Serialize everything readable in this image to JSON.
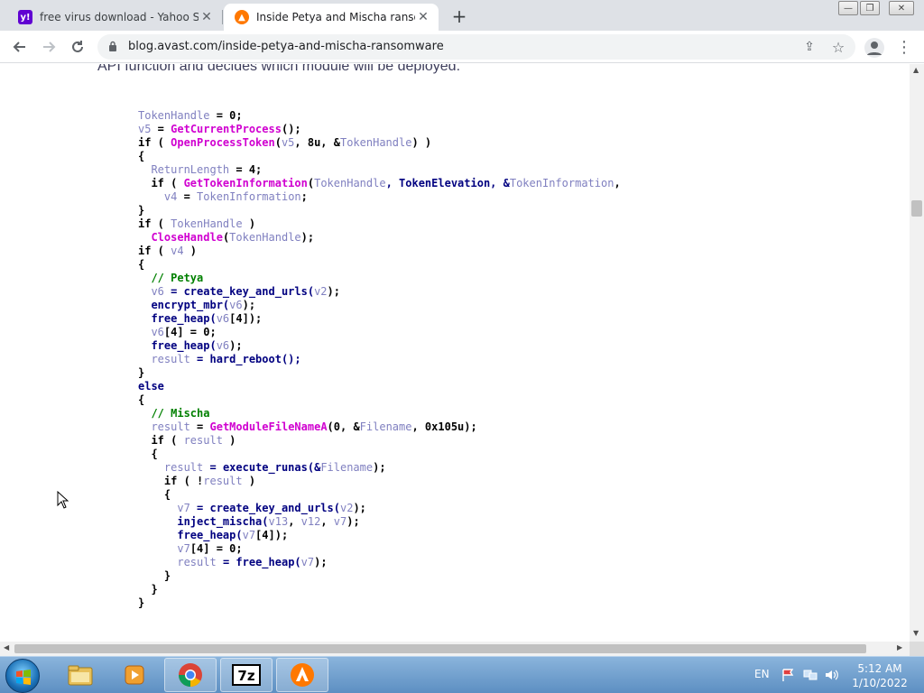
{
  "browser": {
    "tabs": [
      {
        "title": "free virus download - Yahoo Sear",
        "favicon": "yahoo-icon",
        "active": false
      },
      {
        "title": "Inside Petya and Mischa ransomw",
        "favicon": "avast-icon",
        "active": true
      }
    ],
    "address": "blog.avast.com/inside-petya-and-mischa-ransomware"
  },
  "article": {
    "lead_text": "API function and decides which module will be deployed.",
    "code_lines": [
      [
        {
          "t": "TokenHandle",
          "k": "v"
        },
        {
          "t": " = 0;",
          "k": "n"
        }
      ],
      [
        {
          "t": "v5",
          "k": "v"
        },
        {
          "t": " = ",
          "k": "n"
        },
        {
          "t": "GetCurrentProcess",
          "k": "f"
        },
        {
          "t": "();",
          "k": "n"
        }
      ],
      [
        {
          "t": "if ( ",
          "k": "n"
        },
        {
          "t": "OpenProcessToken",
          "k": "f"
        },
        {
          "t": "(",
          "k": "n"
        },
        {
          "t": "v5",
          "k": "v"
        },
        {
          "t": ", 8u, &",
          "k": "n"
        },
        {
          "t": "TokenHandle",
          "k": "v"
        },
        {
          "t": ") )",
          "k": "n"
        }
      ],
      [
        {
          "t": "{",
          "k": "n"
        }
      ],
      [
        {
          "t": "  ",
          "k": "n"
        },
        {
          "t": "ReturnLength",
          "k": "v"
        },
        {
          "t": " = 4;",
          "k": "n"
        }
      ],
      [
        {
          "t": "  if ( ",
          "k": "n"
        },
        {
          "t": "GetTokenInformation",
          "k": "f"
        },
        {
          "t": "(",
          "k": "n"
        },
        {
          "t": "TokenHandle",
          "k": "v"
        },
        {
          "t": ", TokenElevation, &",
          "k": "k"
        },
        {
          "t": "TokenInformation",
          "k": "v"
        },
        {
          "t": ",",
          "k": "n"
        }
      ],
      [
        {
          "t": "    ",
          "k": "n"
        },
        {
          "t": "v4",
          "k": "v"
        },
        {
          "t": " = ",
          "k": "n"
        },
        {
          "t": "TokenInformation",
          "k": "v"
        },
        {
          "t": ";",
          "k": "n"
        }
      ],
      [
        {
          "t": "}",
          "k": "n"
        }
      ],
      [
        {
          "t": "if ( ",
          "k": "n"
        },
        {
          "t": "TokenHandle",
          "k": "v"
        },
        {
          "t": " )",
          "k": "n"
        }
      ],
      [
        {
          "t": "  ",
          "k": "n"
        },
        {
          "t": "CloseHandle",
          "k": "f"
        },
        {
          "t": "(",
          "k": "n"
        },
        {
          "t": "TokenHandle",
          "k": "v"
        },
        {
          "t": ");",
          "k": "n"
        }
      ],
      [
        {
          "t": "if ( ",
          "k": "n"
        },
        {
          "t": "v4",
          "k": "v"
        },
        {
          "t": " )",
          "k": "n"
        }
      ],
      [
        {
          "t": "{",
          "k": "n"
        }
      ],
      [
        {
          "t": "  ",
          "k": "n"
        },
        {
          "t": "// Petya",
          "k": "c"
        }
      ],
      [
        {
          "t": "  ",
          "k": "n"
        },
        {
          "t": "v6",
          "k": "v"
        },
        {
          "t": " = create_key_and_urls(",
          "k": "k"
        },
        {
          "t": "v2",
          "k": "v"
        },
        {
          "t": ");",
          "k": "n"
        }
      ],
      [
        {
          "t": "  encrypt_mbr(",
          "k": "k"
        },
        {
          "t": "v6",
          "k": "v"
        },
        {
          "t": ");",
          "k": "n"
        }
      ],
      [
        {
          "t": "  free_heap(",
          "k": "k"
        },
        {
          "t": "v6",
          "k": "v"
        },
        {
          "t": "[4]);",
          "k": "n"
        }
      ],
      [
        {
          "t": "  ",
          "k": "n"
        },
        {
          "t": "v6",
          "k": "v"
        },
        {
          "t": "[4] = 0;",
          "k": "n"
        }
      ],
      [
        {
          "t": "  free_heap(",
          "k": "k"
        },
        {
          "t": "v6",
          "k": "v"
        },
        {
          "t": ");",
          "k": "n"
        }
      ],
      [
        {
          "t": "  ",
          "k": "n"
        },
        {
          "t": "result",
          "k": "v"
        },
        {
          "t": " = hard_reboot();",
          "k": "k"
        }
      ],
      [
        {
          "t": "}",
          "k": "n"
        }
      ],
      [
        {
          "t": "else",
          "k": "k"
        }
      ],
      [
        {
          "t": "{",
          "k": "n"
        }
      ],
      [
        {
          "t": "  ",
          "k": "n"
        },
        {
          "t": "// Mischa",
          "k": "c"
        }
      ],
      [
        {
          "t": "  ",
          "k": "n"
        },
        {
          "t": "result",
          "k": "v"
        },
        {
          "t": " = ",
          "k": "n"
        },
        {
          "t": "GetModuleFileNameA",
          "k": "f"
        },
        {
          "t": "(0, &",
          "k": "n"
        },
        {
          "t": "Filename",
          "k": "v"
        },
        {
          "t": ", 0x105u);",
          "k": "n"
        }
      ],
      [
        {
          "t": "  if ( ",
          "k": "n"
        },
        {
          "t": "result",
          "k": "v"
        },
        {
          "t": " )",
          "k": "n"
        }
      ],
      [
        {
          "t": "  {",
          "k": "n"
        }
      ],
      [
        {
          "t": "    ",
          "k": "n"
        },
        {
          "t": "result",
          "k": "v"
        },
        {
          "t": " = execute_runas(&",
          "k": "k"
        },
        {
          "t": "Filename",
          "k": "v"
        },
        {
          "t": ");",
          "k": "n"
        }
      ],
      [
        {
          "t": "    if ( !",
          "k": "n"
        },
        {
          "t": "result",
          "k": "v"
        },
        {
          "t": " )",
          "k": "n"
        }
      ],
      [
        {
          "t": "    {",
          "k": "n"
        }
      ],
      [
        {
          "t": "      ",
          "k": "n"
        },
        {
          "t": "v7",
          "k": "v"
        },
        {
          "t": " = create_key_and_urls(",
          "k": "k"
        },
        {
          "t": "v2",
          "k": "v"
        },
        {
          "t": ");",
          "k": "n"
        }
      ],
      [
        {
          "t": "      inject_mischa(",
          "k": "k"
        },
        {
          "t": "v13",
          "k": "v"
        },
        {
          "t": ", ",
          "k": "n"
        },
        {
          "t": "v12",
          "k": "v"
        },
        {
          "t": ", ",
          "k": "n"
        },
        {
          "t": "v7",
          "k": "v"
        },
        {
          "t": ");",
          "k": "n"
        }
      ],
      [
        {
          "t": "      free_heap(",
          "k": "k"
        },
        {
          "t": "v7",
          "k": "v"
        },
        {
          "t": "[4]);",
          "k": "n"
        }
      ],
      [
        {
          "t": "      ",
          "k": "n"
        },
        {
          "t": "v7",
          "k": "v"
        },
        {
          "t": "[4] = 0;",
          "k": "n"
        }
      ],
      [
        {
          "t": "      ",
          "k": "n"
        },
        {
          "t": "result",
          "k": "v"
        },
        {
          "t": " = free_heap(",
          "k": "k"
        },
        {
          "t": "v7",
          "k": "v"
        },
        {
          "t": ");",
          "k": "n"
        }
      ],
      [
        {
          "t": "    }",
          "k": "n"
        }
      ],
      [
        {
          "t": "  }",
          "k": "n"
        }
      ],
      [
        {
          "t": "}",
          "k": "n"
        }
      ]
    ]
  },
  "taskbar": {
    "language": "EN",
    "time": "5:12 AM",
    "date": "1/10/2022",
    "pinned": [
      "explorer-icon",
      "media-player-icon",
      "chrome-icon",
      "7zip-icon",
      "avast-icon"
    ]
  },
  "colors": {
    "code_keyword": "#000080",
    "code_variable": "#8080c0",
    "code_function": "#d000d0",
    "code_comment": "#008000"
  }
}
